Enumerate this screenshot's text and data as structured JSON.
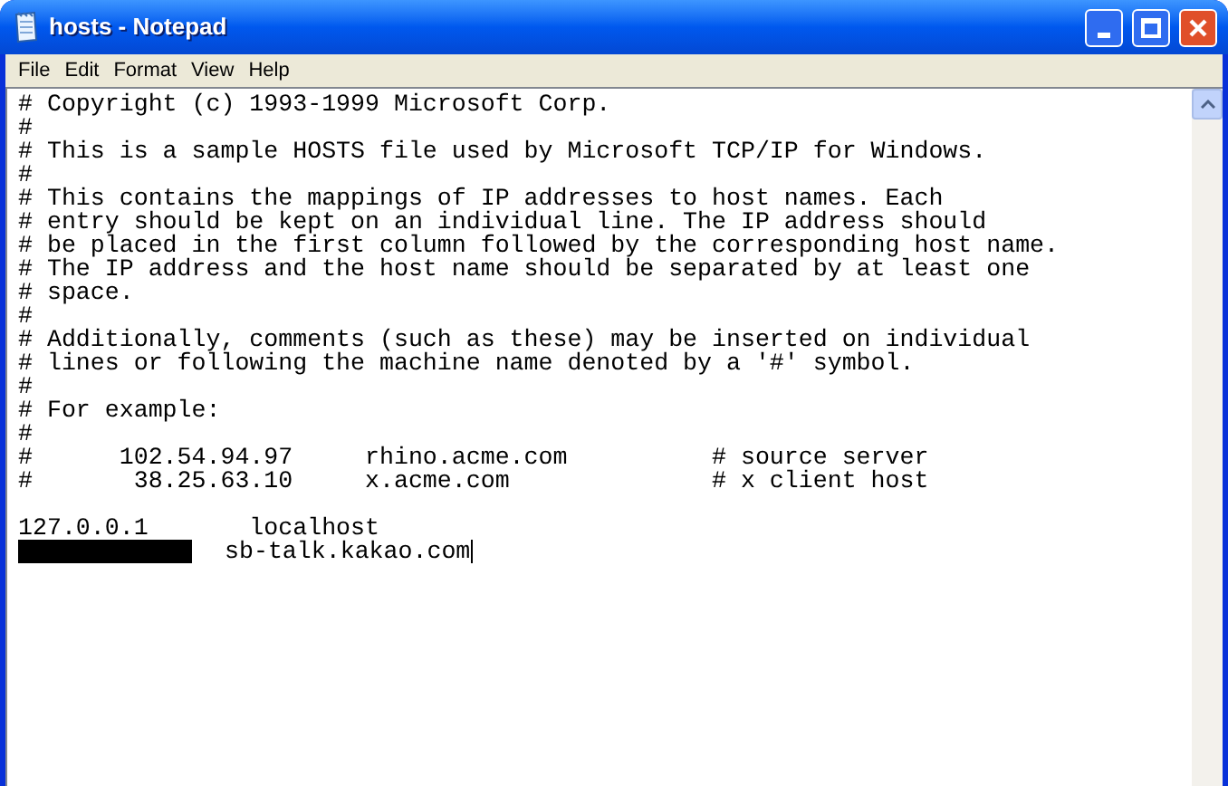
{
  "window": {
    "title": "hosts - Notepad"
  },
  "menu": [
    "File",
    "Edit",
    "Format",
    "View",
    "Help"
  ],
  "editor": {
    "caret": true,
    "lines": [
      {
        "kind": "text",
        "text": "# Copyright (c) 1993-1999 Microsoft Corp."
      },
      {
        "kind": "text",
        "text": "#"
      },
      {
        "kind": "text",
        "text": "# This is a sample HOSTS file used by Microsoft TCP/IP for Windows."
      },
      {
        "kind": "text",
        "text": "#"
      },
      {
        "kind": "text",
        "text": "# This contains the mappings of IP addresses to host names. Each"
      },
      {
        "kind": "text",
        "text": "# entry should be kept on an individual line. The IP address should"
      },
      {
        "kind": "text",
        "text": "# be placed in the first column followed by the corresponding host name."
      },
      {
        "kind": "text",
        "text": "# The IP address and the host name should be separated by at least one"
      },
      {
        "kind": "text",
        "text": "# space."
      },
      {
        "kind": "text",
        "text": "#"
      },
      {
        "kind": "text",
        "text": "# Additionally, comments (such as these) may be inserted on individual"
      },
      {
        "kind": "text",
        "text": "# lines or following the machine name denoted by a '#' symbol."
      },
      {
        "kind": "text",
        "text": "#"
      },
      {
        "kind": "text",
        "text": "# For example:"
      },
      {
        "kind": "text",
        "text": "#"
      },
      {
        "kind": "text",
        "text": "#      102.54.94.97     rhino.acme.com          # source server"
      },
      {
        "kind": "text",
        "text": "#       38.25.63.10     x.acme.com              # x client host"
      },
      {
        "kind": "blank"
      },
      {
        "kind": "text",
        "text": "127.0.0.1       localhost"
      },
      {
        "kind": "redacted",
        "text": "sb-talk.kakao.com"
      }
    ]
  }
}
